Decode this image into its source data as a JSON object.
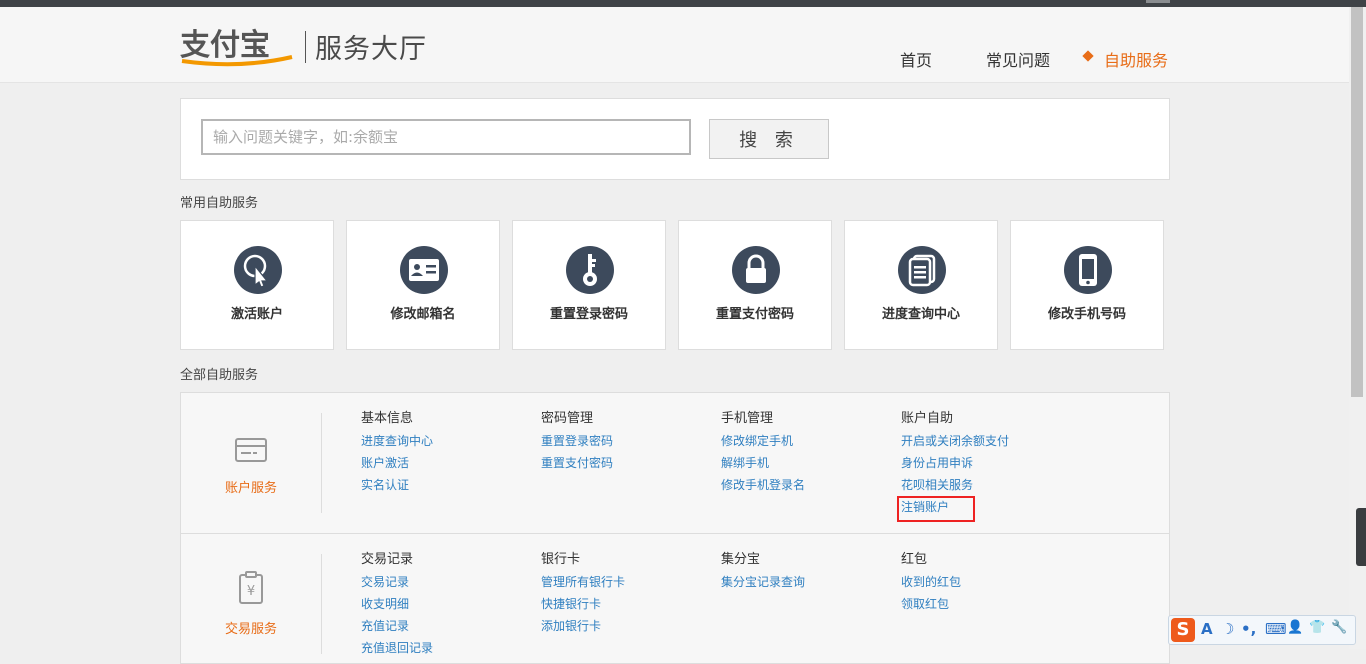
{
  "header": {
    "logo_text": "支付宝",
    "subtitle": "服务大厅",
    "nav": [
      {
        "label": "首页",
        "active": false
      },
      {
        "label": "常见问题",
        "active": false
      },
      {
        "label": "自助服务",
        "active": true
      }
    ],
    "accent_color": "#e86d18"
  },
  "search": {
    "placeholder": "输入问题关键字，如:余额宝",
    "button_label": "搜 索"
  },
  "common_services": {
    "title": "常用自助服务",
    "items": [
      {
        "label": "激活账户",
        "icon": "cursor-click-icon"
      },
      {
        "label": "修改邮箱名",
        "icon": "id-card-icon"
      },
      {
        "label": "重置登录密码",
        "icon": "key-icon"
      },
      {
        "label": "重置支付密码",
        "icon": "lock-icon"
      },
      {
        "label": "进度查询中心",
        "icon": "documents-icon"
      },
      {
        "label": "修改手机号码",
        "icon": "mobile-phone-icon"
      }
    ]
  },
  "all_services": {
    "title": "全部自助服务",
    "categories": [
      {
        "label": "账户服务",
        "icon": "card-icon",
        "columns": [
          {
            "heading": "基本信息",
            "links": [
              "进度查询中心",
              "账户激活",
              "实名认证"
            ]
          },
          {
            "heading": "密码管理",
            "links": [
              "重置登录密码",
              "重置支付密码"
            ]
          },
          {
            "heading": "手机管理",
            "links": [
              "修改绑定手机",
              "解绑手机",
              "修改手机登录名"
            ]
          },
          {
            "heading": "账户自助",
            "links": [
              "开启或关闭余额支付",
              "身份占用申诉",
              "花呗相关服务",
              "注销账户"
            ]
          }
        ]
      },
      {
        "label": "交易服务",
        "icon": "receipt-yuan-icon",
        "columns": [
          {
            "heading": "交易记录",
            "links": [
              "交易记录",
              "收支明细",
              "充值记录",
              "充值退回记录"
            ]
          },
          {
            "heading": "银行卡",
            "links": [
              "管理所有银行卡",
              "快捷银行卡",
              "添加银行卡"
            ]
          },
          {
            "heading": "集分宝",
            "links": [
              "集分宝记录查询"
            ]
          },
          {
            "heading": "红包",
            "links": [
              "收到的红包",
              "领取红包"
            ]
          }
        ]
      }
    ]
  },
  "ime_toolbar": {
    "logo": "S",
    "items": [
      "A",
      "☽",
      "•,",
      "⌨",
      "👤",
      "👕",
      "🔧"
    ]
  }
}
